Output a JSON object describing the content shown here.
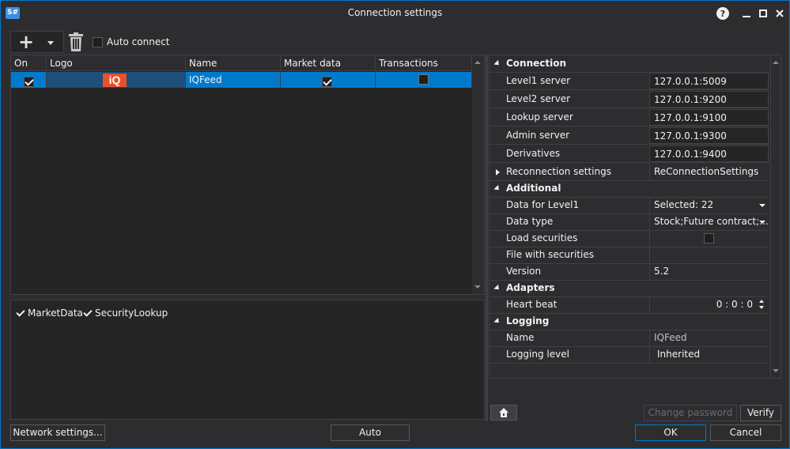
{
  "window": {
    "title": "Connection settings",
    "app_icon": "S#"
  },
  "toolbar": {
    "auto_connect_label": "Auto connect",
    "auto_connect_checked": false
  },
  "grid": {
    "columns": [
      "On",
      "Logo",
      "Name",
      "Market data",
      "Transactions"
    ],
    "rows": [
      {
        "on": true,
        "logo": "iQ",
        "name": "IQFeed",
        "market_data": true,
        "transactions": false
      }
    ]
  },
  "capabilities": [
    "MarketData",
    "SecurityLookup"
  ],
  "properties": {
    "connection": {
      "label": "Connection",
      "items": [
        {
          "name": "Level1 server",
          "value": "127.0.0.1:5009"
        },
        {
          "name": "Level2 server",
          "value": "127.0.0.1:9200"
        },
        {
          "name": "Lookup server",
          "value": "127.0.0.1:9100"
        },
        {
          "name": "Admin server",
          "value": "127.0.0.1:9300"
        },
        {
          "name": "Derivatives",
          "value": "127.0.0.1:9400"
        }
      ]
    },
    "reconnection": {
      "name": "Reconnection settings",
      "value": "ReConnectionSettings"
    },
    "additional": {
      "label": "Additional",
      "data_for_level1": {
        "name": "Data for Level1",
        "value": "Selected: 22"
      },
      "data_type": {
        "name": "Data type",
        "value": "Stock;Future contract;..."
      },
      "load_securities": {
        "name": "Load securities",
        "checked": false
      },
      "file_with_securities": {
        "name": "File with securities",
        "value": ""
      },
      "version": {
        "name": "Version",
        "value": "5.2"
      }
    },
    "adapters": {
      "label": "Adapters",
      "heart_beat": {
        "name": "Heart beat",
        "value": "0 : 0 : 0"
      }
    },
    "logging": {
      "label": "Logging",
      "name_row": {
        "name": "Name",
        "value": "IQFeed"
      },
      "level": {
        "name": "Logging level",
        "value": "Inherited"
      }
    }
  },
  "buttons": {
    "change_password": "Change password",
    "verify": "Verify",
    "network_settings": "Network settings...",
    "auto": "Auto",
    "ok": "OK",
    "cancel": "Cancel"
  },
  "colors": {
    "accent": "#007acc",
    "background": "#2d2d30",
    "logo": "#e8512a"
  }
}
